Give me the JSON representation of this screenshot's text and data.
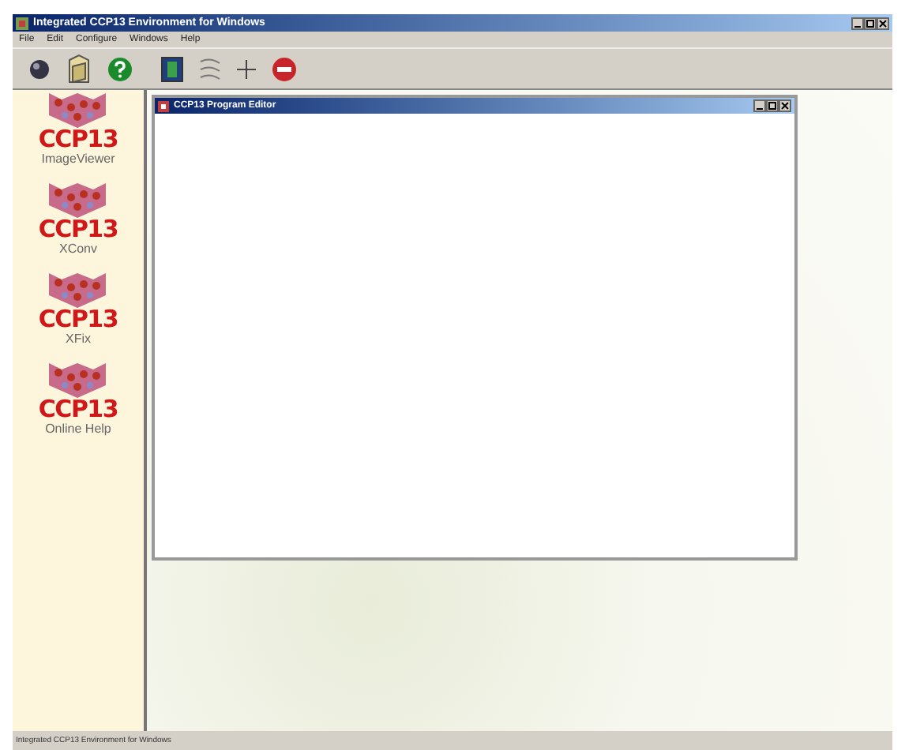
{
  "window": {
    "title": "Integrated CCP13 Environment for Windows"
  },
  "menu": [
    "File",
    "Edit",
    "Configure",
    "Windows",
    "Help"
  ],
  "toolbar": [
    {
      "kind": "sphere"
    },
    {
      "kind": "folder"
    },
    {
      "kind": "help"
    },
    {
      "kind": "panel"
    },
    {
      "kind": "lines"
    },
    {
      "kind": "cross"
    },
    {
      "kind": "stop"
    }
  ],
  "sidebar": {
    "items": [
      {
        "logo": "CCP13",
        "label": "ImageViewer"
      },
      {
        "logo": "CCP13",
        "label": "XConv"
      },
      {
        "logo": "CCP13",
        "label": "XFix"
      },
      {
        "logo": "CCP13",
        "label": "Online Help"
      }
    ]
  },
  "editor": {
    "title": "CCP13 Program Editor"
  },
  "status_bar": "Integrated CCP13 Environment for Windows"
}
